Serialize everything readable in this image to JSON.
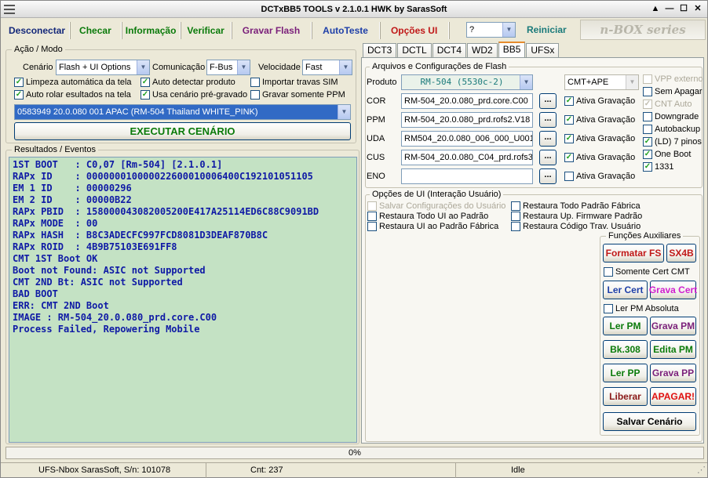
{
  "window": {
    "title": "DCTxBB5 TOOLS v 2.1.0.1 HWK by SarasSoft"
  },
  "toolbar": {
    "disconnect": "Desconectar",
    "check": "Checar",
    "info": "Informação",
    "verify": "Verificar",
    "flash": "Gravar Flash",
    "autotest": "AutoTeste",
    "ui_options": "Opções UI",
    "help_select": "?",
    "restart": "Reiniciar",
    "brand": "n-BOX series"
  },
  "mode": {
    "group": "Ação / Modo",
    "scenario_label": "Cenário",
    "scenario_value": "Flash + UI Options",
    "comm_label": "Comunicação",
    "comm_value": "F-Bus",
    "speed_label": "Velocidade",
    "speed_value": "Fast",
    "opts": [
      {
        "label": "Limpeza automática da tela",
        "checked": true
      },
      {
        "label": "Auto detectar produto",
        "checked": true
      },
      {
        "label": "Importar travas SIM",
        "checked": false
      },
      {
        "label": "Auto rolar esultados na tela",
        "checked": true
      },
      {
        "label": "Usa cenário pré-gravado",
        "checked": true
      },
      {
        "label": "Gravar somente PPM",
        "checked": false
      }
    ],
    "preset": "0583949 20.0.080 001 APAC (RM-504 Thailand WHITE_PINK)",
    "execute": "EXECUTAR CENÁRIO"
  },
  "results": {
    "group": "Resultados / Eventos",
    "lines": [
      "1ST BOOT   : C0,07 [Rm-504] [2.1.0.1]",
      "RAPx ID    : 000000010000022600010006400C192101051105",
      "EM 1 ID    : 00000296",
      "EM 2 ID    : 00000B22",
      "RAPx PBID  : 158000043082005200E417A25114ED6C88C9091BD",
      "RAPx MODE  : 00",
      "RAPx HASH  : B8C3ADECFC997FCD8081D3DEAF870B8C",
      "RAPx ROID  : 4B9B75103E691FF8",
      "CMT 1ST Boot OK",
      "Boot not Found: ASIC not Supported",
      "CMT 2ND Bt: ASIC not Supported",
      "BAD BOOT",
      "ERR: CMT 2ND Boot",
      "IMAGE : RM-504_20.0.080_prd.core.C00",
      "Process Failed, Repowering Mobile"
    ]
  },
  "tabs": [
    "DCT3",
    "DCTL",
    "DCT4",
    "WD2",
    "BB5",
    "UFSx"
  ],
  "flash": {
    "group": "Arquivos e Configurações de Flash",
    "product_label": "Produto",
    "product_value": "RM-504 (5530c-2)",
    "cmt_value": "CMT+APE",
    "files": [
      {
        "label": "COR",
        "file": "RM-504_20.0.080_prd.core.C00",
        "btn": "...",
        "ativa": "Ativa Gravação"
      },
      {
        "label": "PPM",
        "file": "RM-504_20.0.080_prd.rofs2.V18",
        "btn": "...",
        "ativa": "Ativa Gravação"
      },
      {
        "label": "UDA",
        "file": "RM504_20.0.080_006_000_U001",
        "btn": "...",
        "ativa": "Ativa Gravação"
      },
      {
        "label": "CUS",
        "file": "RM-504_20.0.080_C04_prd.rofs3.",
        "btn": "...",
        "ativa": "Ativa Gravação"
      },
      {
        "label": "ENO",
        "file": "",
        "btn": "...",
        "ativa": "Ativa Gravação"
      }
    ],
    "right_opts": [
      {
        "label": "VPP externo",
        "checked": false,
        "disabled": true
      },
      {
        "label": "Sem Apagar",
        "checked": false
      },
      {
        "label": "CNT Auto",
        "checked": true,
        "disabled": true
      },
      {
        "label": "Downgrade",
        "checked": false
      },
      {
        "label": "Autobackup",
        "checked": false
      },
      {
        "label": "(LD) 7 pinos",
        "checked": true
      },
      {
        "label": "One Boot",
        "checked": true
      },
      {
        "label": "1331",
        "checked": true
      }
    ]
  },
  "ui": {
    "group": "Opções de UI (Interação Usuário)",
    "left": [
      {
        "label": "Salvar Configurações do Usuário",
        "disabled": true
      },
      {
        "label": "Restaura Todo UI ao Padrão"
      },
      {
        "label": "Restaura UI ao Padrão Fábrica"
      }
    ],
    "right": [
      {
        "label": "Restaura Todo Padrão Fábrica"
      },
      {
        "label": "Restaura Up. Firmware Padrão"
      },
      {
        "label": "Restaura Código Trav. Usuário"
      }
    ]
  },
  "aux": {
    "group": "Funções Auxiliares",
    "format_fs": "Formatar FS",
    "sx4b": "SX4B",
    "only_cert": "Somente Cert CMT",
    "read_cert": "Ler Cert",
    "write_cert": "Grava Cert",
    "read_pm_abs": "Ler PM Absoluta",
    "read_pm": "Ler PM",
    "write_pm": "Grava PM",
    "bk308": "Bk.308",
    "edit_pm": "Edita PM",
    "read_pp": "Ler PP",
    "write_pp": "Grava PP",
    "unlock": "Liberar",
    "erase": "APAGAR!",
    "save_scenario": "Salvar Cenário"
  },
  "progress": {
    "text": "0%",
    "value": 0
  },
  "status": {
    "serial": "UFS-Nbox SarasSoft, S/n: 101078",
    "count": "Cnt: 237",
    "state": "Idle"
  },
  "colors": {
    "green": "#0a7a0a",
    "purple": "#7a1f7a",
    "blue": "#1e3fa8",
    "red": "#c01818",
    "magenta": "#d020d0",
    "console_bg": "#c4e2c4",
    "console_fg": "#0f1aa5"
  }
}
